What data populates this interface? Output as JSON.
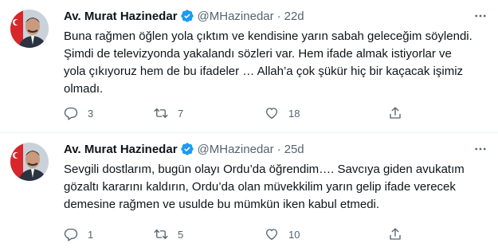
{
  "tweets": [
    {
      "author_name": "Av. Murat Hazinedar",
      "handle": "@MHazinedar",
      "separator": "·",
      "time": "22d",
      "lines": [
        "Buna rağmen öğlen yola çıktım ve kendisine yarın sabah geleceğim söylendi.",
        "Şimdi de televizyonda yakalandı sözleri var. Hem ifade almak istiyorlar ve",
        "yola çıkıyoruz hem de bu ifadeler … Allah’a çok şükür hiç bir kaçacak işimiz",
        "olmadı."
      ],
      "replies": "3",
      "retweets": "7",
      "likes": "18"
    },
    {
      "author_name": "Av. Murat Hazinedar",
      "handle": "@MHazinedar",
      "separator": "·",
      "time": "25d",
      "lines": [
        "Sevgili dostlarım, bugün olayı Ordu’da öğrendim…. Savcıya giden avukatım",
        "gözaltı kararını kaldırın, Ordu’da olan müvekkilim yarın gelip ifade verecek",
        "demesine rağmen ve usulde bu mümkün iken kabul etmedi."
      ],
      "replies": "1",
      "retweets": "5",
      "likes": "10"
    }
  ],
  "colors": {
    "text": "#0f1419",
    "secondary": "#536471",
    "verified": "#1d9bf0",
    "divider": "#eff3f4"
  },
  "icons": [
    "verified-badge-icon",
    "more-options-icon",
    "reply-icon",
    "retweet-icon",
    "like-icon",
    "share-icon"
  ]
}
